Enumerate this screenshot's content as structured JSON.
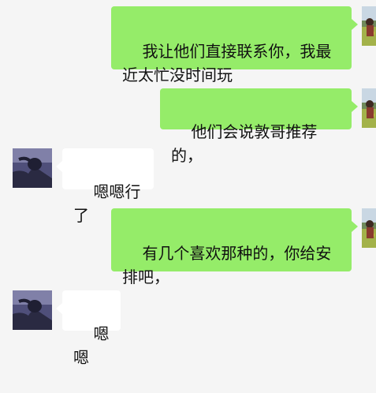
{
  "conversation": {
    "colors": {
      "background": "#f5f5f5",
      "outgoing_bubble": "#95ec69",
      "incoming_bubble": "#ffffff"
    },
    "messages": [
      {
        "sender": "self",
        "text": "我让他们直接联系你，我最近太忙没时间玩"
      },
      {
        "sender": "self",
        "text": "他们会说敦哥推荐的，"
      },
      {
        "sender": "contact",
        "text": "嗯嗯行了"
      },
      {
        "sender": "self",
        "text": "有几个喜欢那种的，你给安排吧，"
      },
      {
        "sender": "contact",
        "text": "嗯嗯"
      }
    ]
  }
}
